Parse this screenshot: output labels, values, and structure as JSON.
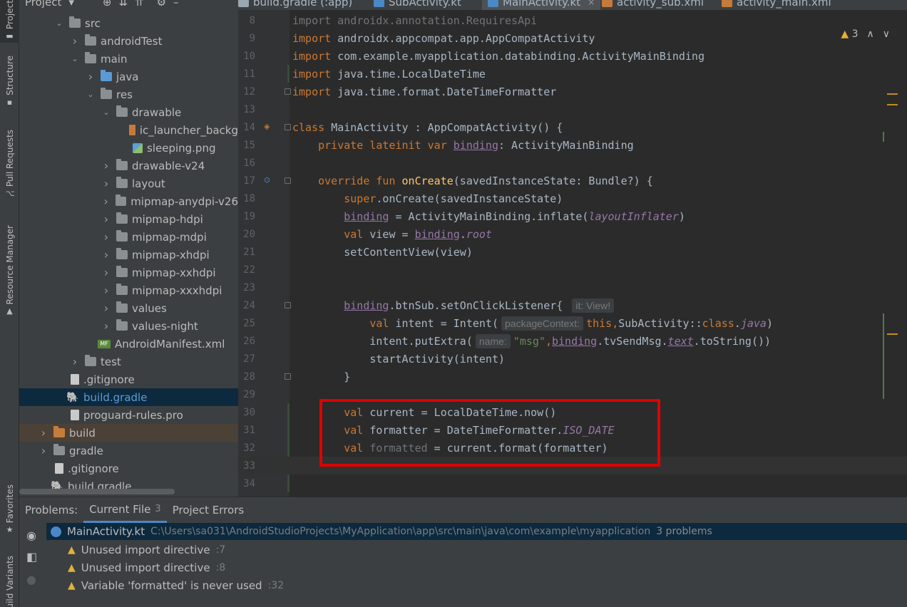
{
  "sidebar_tabs": {
    "project": "Project",
    "structure": "Structure",
    "pull_requests": "Pull Requests",
    "resource_manager": "Resource Manager",
    "favorites": "Favorites",
    "build_variants": "Build Variants"
  },
  "project_panel": {
    "header_label": "Project",
    "tree": [
      {
        "label": "src",
        "indent": 2,
        "chevron": "down",
        "icon": "folder"
      },
      {
        "label": "androidTest",
        "indent": 3,
        "chevron": "right",
        "icon": "folder"
      },
      {
        "label": "main",
        "indent": 3,
        "chevron": "down",
        "icon": "folder"
      },
      {
        "label": "java",
        "indent": 4,
        "chevron": "right",
        "icon": "folder-blue"
      },
      {
        "label": "res",
        "indent": 4,
        "chevron": "down",
        "icon": "folder"
      },
      {
        "label": "drawable",
        "indent": 5,
        "chevron": "down",
        "icon": "folder"
      },
      {
        "label": "ic_launcher_backg",
        "indent": 6,
        "chevron": "",
        "icon": "file-xml"
      },
      {
        "label": "sleeping.png",
        "indent": 6,
        "chevron": "",
        "icon": "file-img"
      },
      {
        "label": "drawable-v24",
        "indent": 5,
        "chevron": "right",
        "icon": "folder"
      },
      {
        "label": "layout",
        "indent": 5,
        "chevron": "right",
        "icon": "folder"
      },
      {
        "label": "mipmap-anydpi-v26",
        "indent": 5,
        "chevron": "right",
        "icon": "folder"
      },
      {
        "label": "mipmap-hdpi",
        "indent": 5,
        "chevron": "right",
        "icon": "folder"
      },
      {
        "label": "mipmap-mdpi",
        "indent": 5,
        "chevron": "right",
        "icon": "folder"
      },
      {
        "label": "mipmap-xhdpi",
        "indent": 5,
        "chevron": "right",
        "icon": "folder"
      },
      {
        "label": "mipmap-xxhdpi",
        "indent": 5,
        "chevron": "right",
        "icon": "folder"
      },
      {
        "label": "mipmap-xxxhdpi",
        "indent": 5,
        "chevron": "right",
        "icon": "folder"
      },
      {
        "label": "values",
        "indent": 5,
        "chevron": "right",
        "icon": "folder"
      },
      {
        "label": "values-night",
        "indent": 5,
        "chevron": "right",
        "icon": "folder"
      },
      {
        "label": "AndroidManifest.xml",
        "indent": 4,
        "chevron": "",
        "icon": "manifest"
      },
      {
        "label": "test",
        "indent": 3,
        "chevron": "right",
        "icon": "folder"
      },
      {
        "label": ".gitignore",
        "indent": 2,
        "chevron": "",
        "icon": "file"
      },
      {
        "label": "build.gradle",
        "indent": 2,
        "chevron": "",
        "icon": "gradle",
        "selected": true
      },
      {
        "label": "proguard-rules.pro",
        "indent": 2,
        "chevron": "",
        "icon": "file"
      },
      {
        "label": "build",
        "indent": 1,
        "chevron": "right",
        "icon": "folder-orange",
        "excluded": true
      },
      {
        "label": "gradle",
        "indent": 1,
        "chevron": "right",
        "icon": "folder"
      },
      {
        "label": ".gitignore",
        "indent": 1,
        "chevron": "",
        "icon": "file"
      },
      {
        "label": "build.gradle",
        "indent": 1,
        "chevron": "",
        "icon": "gradle"
      }
    ]
  },
  "editor_tabs": [
    {
      "label": "build.gradle (:app)",
      "color": "#9aa7b0"
    },
    {
      "label": "SubActivity.kt",
      "color": "#4a88c7"
    },
    {
      "label": "MainActivity.kt",
      "color": "#4a88c7",
      "active": true
    },
    {
      "label": "activity_sub.xml",
      "color": "#c47b3a"
    },
    {
      "label": "activity_main.xml",
      "color": "#c47b3a"
    }
  ],
  "editor": {
    "warning_count": "3",
    "lines": [
      {
        "n": "8",
        "segs": [
          [
            "dim",
            "import androidx.annotation.RequiresApi"
          ]
        ]
      },
      {
        "n": "9",
        "segs": [
          [
            "k",
            "import "
          ],
          [
            "",
            "androidx.appcompat.app.AppCompatActivity"
          ]
        ]
      },
      {
        "n": "10",
        "segs": [
          [
            "k",
            "import "
          ],
          [
            "",
            "com.example.myapplication.databinding.ActivityMainBinding"
          ]
        ]
      },
      {
        "n": "11",
        "segs": [
          [
            "k",
            "import "
          ],
          [
            "",
            "java.time.LocalDateTime"
          ]
        ]
      },
      {
        "n": "12",
        "segs": [
          [
            "k",
            "import "
          ],
          [
            "",
            "java.time.format.DateTimeFormatter"
          ]
        ]
      },
      {
        "n": "13",
        "segs": []
      },
      {
        "n": "14",
        "segs": [
          [
            "k",
            "class "
          ],
          [
            "",
            "MainActivity : AppCompatActivity() {"
          ]
        ]
      },
      {
        "n": "15",
        "segs": [
          [
            "",
            "    "
          ],
          [
            "k",
            "private lateinit var "
          ],
          [
            "prop ul",
            "binding"
          ],
          [
            "",
            ": ActivityMainBinding"
          ]
        ]
      },
      {
        "n": "16",
        "segs": []
      },
      {
        "n": "17",
        "segs": [
          [
            "",
            "    "
          ],
          [
            "k",
            "override fun "
          ],
          [
            "fn",
            "onCreate"
          ],
          [
            "",
            "(savedInstanceState: Bundle?) {"
          ]
        ]
      },
      {
        "n": "18",
        "segs": [
          [
            "",
            "        "
          ],
          [
            "k",
            "super"
          ],
          [
            "",
            ".onCreate(savedInstanceState)"
          ]
        ]
      },
      {
        "n": "19",
        "segs": [
          [
            "",
            "        "
          ],
          [
            "prop ul",
            "binding"
          ],
          [
            "",
            " = ActivityMainBinding.inflate("
          ],
          [
            "prop ital",
            "layoutInflater"
          ],
          [
            "",
            ")"
          ]
        ]
      },
      {
        "n": "20",
        "segs": [
          [
            "",
            "        "
          ],
          [
            "k",
            "val "
          ],
          [
            "",
            "view = "
          ],
          [
            "prop ul",
            "binding"
          ],
          [
            "",
            "."
          ],
          [
            "prop ital",
            "root"
          ]
        ]
      },
      {
        "n": "21",
        "segs": [
          [
            "",
            "        setContentView(view)"
          ]
        ]
      },
      {
        "n": "22",
        "segs": []
      },
      {
        "n": "23",
        "segs": []
      },
      {
        "n": "24",
        "segs": [
          [
            "",
            "        "
          ],
          [
            "prop ul",
            "binding"
          ],
          [
            "",
            ".btnSub.setOnClickListener{ "
          ],
          [
            "hint",
            "it: View!"
          ]
        ]
      },
      {
        "n": "25",
        "segs": [
          [
            "",
            "            "
          ],
          [
            "k",
            "val "
          ],
          [
            "",
            "intent = Intent("
          ],
          [
            "hint",
            "packageContext:"
          ],
          [
            "k",
            "this"
          ],
          [
            "k",
            ","
          ],
          [
            "",
            "SubActivity::"
          ],
          [
            "k",
            "class"
          ],
          [
            "",
            "."
          ],
          [
            "prop ital",
            "java"
          ],
          [
            "",
            ")"
          ]
        ]
      },
      {
        "n": "26",
        "segs": [
          [
            "",
            "            intent.putExtra("
          ],
          [
            "hint",
            "name:"
          ],
          [
            "str",
            "\"msg\""
          ],
          [
            "k",
            ","
          ],
          [
            "prop ul",
            "binding"
          ],
          [
            "",
            ".tvSendMsg."
          ],
          [
            "prop ital ul",
            "text"
          ],
          [
            "",
            ".toString())"
          ]
        ]
      },
      {
        "n": "27",
        "segs": [
          [
            "",
            "            startActivity(intent)"
          ]
        ]
      },
      {
        "n": "28",
        "segs": [
          [
            "",
            "        }"
          ]
        ]
      },
      {
        "n": "29",
        "segs": []
      },
      {
        "n": "30",
        "segs": [
          [
            "",
            "        "
          ],
          [
            "k",
            "val "
          ],
          [
            "",
            "current = LocalDateTime.now()"
          ]
        ]
      },
      {
        "n": "31",
        "segs": [
          [
            "",
            "        "
          ],
          [
            "k",
            "val "
          ],
          [
            "",
            "formatter = DateTimeFormatter."
          ],
          [
            "prop ital",
            "ISO_DATE"
          ]
        ]
      },
      {
        "n": "32",
        "segs": [
          [
            "",
            "        "
          ],
          [
            "k",
            "val "
          ],
          [
            "dim",
            "formatted"
          ],
          [
            "",
            " = current.format(formatter)"
          ]
        ]
      },
      {
        "n": "33",
        "segs": [],
        "current": true
      },
      {
        "n": "34",
        "segs": []
      }
    ]
  },
  "problems_panel": {
    "tabs": [
      {
        "label": "Problems:"
      },
      {
        "label": "Current File",
        "count": "3",
        "active": true
      },
      {
        "label": "Project Errors"
      }
    ],
    "file_row": {
      "name": "MainActivity.kt",
      "path": "C:\\Users\\sa031\\AndroidStudioProjects\\MyApplication\\app\\src\\main\\java\\com\\example\\myapplication",
      "count": "3 problems"
    },
    "items": [
      {
        "message": "Unused import directive",
        "line": ":7"
      },
      {
        "message": "Unused import directive",
        "line": ":8"
      },
      {
        "message": "Variable 'formatted' is never used",
        "line": ":32"
      }
    ]
  }
}
